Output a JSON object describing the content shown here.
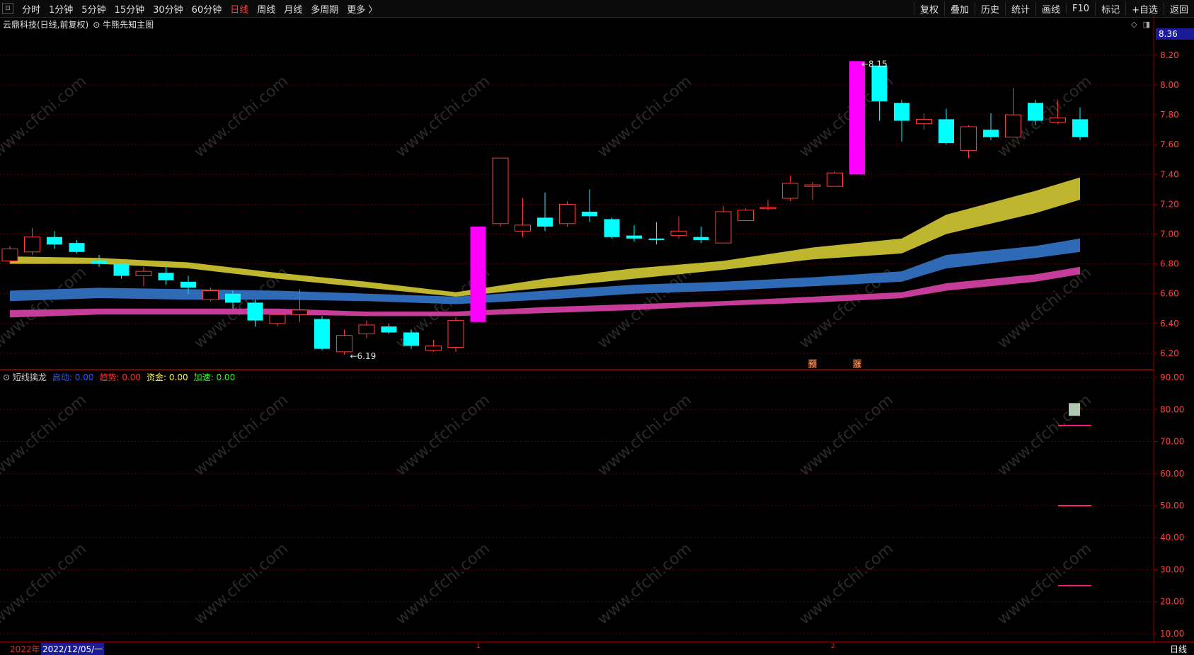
{
  "toolbar": {
    "corner": "⊡",
    "periods": [
      "分时",
      "1分钟",
      "5分钟",
      "15分钟",
      "30分钟",
      "60分钟",
      "日线",
      "周线",
      "月线",
      "多周期",
      "更多 〉"
    ],
    "active_period": "日线",
    "right_tools": [
      "复权",
      "叠加",
      "历史",
      "统计",
      "画线",
      "F10",
      "标记",
      "+自选",
      "返回"
    ]
  },
  "main_chart": {
    "title": "云鼎科技(日线,前复权)",
    "indicator": "牛熊先知主图",
    "current_price": "8.36",
    "high_label": "8.15",
    "low_label": "6.19",
    "markers": [
      "预",
      "涨"
    ],
    "colors": {
      "up": "#ff3b3b",
      "down": "#00ffff",
      "limit_up": "#ff00ff",
      "band_yellow": "#c8c030",
      "band_blue": "#3070c0",
      "band_pink": "#d040a0",
      "grid": "#5a0000",
      "axis_text": "#ff4040"
    }
  },
  "sub_chart": {
    "name": "短线擒龙",
    "fields": [
      {
        "label": "启动:",
        "value": "0.00",
        "color": "#2060ff"
      },
      {
        "label": "趋势:",
        "value": "0.00",
        "color": "#ff3030"
      },
      {
        "label": "资金:",
        "value": "0.00",
        "color": "#ffff40"
      },
      {
        "label": "加速:",
        "value": "0.00",
        "color": "#30ff30"
      }
    ]
  },
  "footer": {
    "year": "2022年",
    "date": "2022/12/05/一",
    "period": "日线",
    "month_markers": [
      "1",
      "2"
    ]
  },
  "watermark": "www.cfchi.com",
  "chart_data": [
    {
      "type": "candlestick",
      "title": "云鼎科技(日线,前复权)",
      "ylim": [
        6.1,
        8.38
      ],
      "yticks": [
        "8.20",
        "8.00",
        "7.80",
        "7.60",
        "7.40",
        "7.20",
        "7.00",
        "6.80",
        "6.60",
        "6.40",
        "6.20"
      ],
      "ytick_values": [
        8.2,
        8.0,
        7.8,
        7.6,
        7.4,
        7.2,
        7.0,
        6.8,
        6.6,
        6.4,
        6.2
      ],
      "candles": [
        [
          6.82,
          6.9,
          6.92,
          6.8
        ],
        [
          6.88,
          6.98,
          7.04,
          6.86
        ],
        [
          6.98,
          6.93,
          7.02,
          6.9
        ],
        [
          6.94,
          6.88,
          6.96,
          6.87
        ],
        [
          6.82,
          6.8,
          6.86,
          6.78
        ],
        [
          6.8,
          6.72,
          6.82,
          6.7
        ],
        [
          6.72,
          6.75,
          6.78,
          6.65
        ],
        [
          6.74,
          6.69,
          6.78,
          6.66
        ],
        [
          6.68,
          6.64,
          6.72,
          6.6
        ],
        [
          6.56,
          6.62,
          6.64,
          6.55
        ],
        [
          6.6,
          6.54,
          6.62,
          6.5
        ],
        [
          6.54,
          6.42,
          6.56,
          6.38
        ],
        [
          6.4,
          6.46,
          6.48,
          6.38
        ],
        [
          6.46,
          6.49,
          6.63,
          6.41
        ],
        [
          6.43,
          6.23,
          6.45,
          6.22
        ],
        [
          6.21,
          6.32,
          6.36,
          6.19
        ],
        [
          6.33,
          6.39,
          6.42,
          6.3
        ],
        [
          6.38,
          6.34,
          6.4,
          6.33
        ],
        [
          6.34,
          6.25,
          6.36,
          6.23
        ],
        [
          6.22,
          6.25,
          6.29,
          6.21
        ],
        [
          6.24,
          6.42,
          6.44,
          6.21
        ],
        [
          6.41,
          7.05,
          7.05,
          6.41
        ],
        [
          7.07,
          7.51,
          7.51,
          7.05
        ],
        [
          7.02,
          7.06,
          7.24,
          6.98
        ],
        [
          7.11,
          7.05,
          7.28,
          7.02
        ],
        [
          7.07,
          7.2,
          7.22,
          7.05
        ],
        [
          7.15,
          7.12,
          7.3,
          7.08
        ],
        [
          7.1,
          6.98,
          7.11,
          6.97
        ],
        [
          6.99,
          6.97,
          7.06,
          6.95
        ],
        [
          6.97,
          6.96,
          7.08,
          6.93
        ],
        [
          6.99,
          7.02,
          7.12,
          6.97
        ],
        [
          6.98,
          6.96,
          7.05,
          6.94
        ],
        [
          6.94,
          7.15,
          7.19,
          6.94
        ],
        [
          7.09,
          7.16,
          7.17,
          7.09
        ],
        [
          7.17,
          7.18,
          7.23,
          7.16
        ],
        [
          7.24,
          7.34,
          7.39,
          7.22
        ],
        [
          7.32,
          7.33,
          7.35,
          7.23
        ],
        [
          7.32,
          7.41,
          7.42,
          7.32
        ],
        [
          7.4,
          8.16,
          8.16,
          7.4
        ],
        [
          8.13,
          7.89,
          8.15,
          7.76
        ],
        [
          7.88,
          7.76,
          7.9,
          7.62
        ],
        [
          7.74,
          7.77,
          7.81,
          7.7
        ],
        [
          7.77,
          7.61,
          7.84,
          7.6
        ],
        [
          7.56,
          7.72,
          7.73,
          7.51
        ],
        [
          7.7,
          7.65,
          7.81,
          7.63
        ],
        [
          7.65,
          7.8,
          7.98,
          7.65
        ],
        [
          7.88,
          7.76,
          7.9,
          7.73
        ],
        [
          7.75,
          7.78,
          7.9,
          7.74
        ],
        [
          7.77,
          7.65,
          7.85,
          7.63
        ]
      ],
      "candle_fields": [
        "open",
        "close",
        "high",
        "low"
      ],
      "bands": [
        {
          "name": "yellow",
          "upper": [
            6.85,
            6.84,
            6.81,
            6.74,
            6.68,
            6.61,
            6.7,
            6.77,
            6.82,
            6.91,
            6.97,
            7.13,
            7.29,
            7.38
          ],
          "lower": [
            6.8,
            6.8,
            6.77,
            6.7,
            6.64,
            6.58,
            6.64,
            6.7,
            6.76,
            6.83,
            6.87,
            7.0,
            7.14,
            7.23
          ]
        },
        {
          "name": "blue",
          "upper": [
            6.62,
            6.64,
            6.63,
            6.62,
            6.6,
            6.58,
            6.62,
            6.66,
            6.68,
            6.71,
            6.75,
            6.86,
            6.92,
            6.97
          ],
          "lower": [
            6.55,
            6.57,
            6.56,
            6.56,
            6.55,
            6.53,
            6.56,
            6.6,
            6.62,
            6.65,
            6.68,
            6.77,
            6.84,
            6.88
          ]
        },
        {
          "name": "pink",
          "upper": [
            6.49,
            6.5,
            6.5,
            6.5,
            6.48,
            6.48,
            6.51,
            6.53,
            6.55,
            6.58,
            6.61,
            6.67,
            6.73,
            6.78
          ],
          "lower": [
            6.44,
            6.46,
            6.46,
            6.46,
            6.45,
            6.45,
            6.47,
            6.49,
            6.52,
            6.54,
            6.57,
            6.62,
            6.68,
            6.73
          ]
        }
      ],
      "band_x_candles": [
        0,
        4,
        8,
        12,
        16,
        20,
        24,
        28,
        32,
        36,
        40,
        42,
        46,
        48
      ]
    },
    {
      "type": "line",
      "title": "短线擒龙",
      "ylim": [
        8,
        92
      ],
      "yticks": [
        "90.00",
        "80.00",
        "70.00",
        "60.00",
        "50.00",
        "40.00",
        "30.00",
        "20.00",
        "10.00"
      ],
      "ytick_values": [
        90,
        80,
        70,
        60,
        50,
        40,
        30,
        20,
        10
      ],
      "levels": [
        75,
        50,
        25
      ],
      "marker_value": 80
    }
  ]
}
